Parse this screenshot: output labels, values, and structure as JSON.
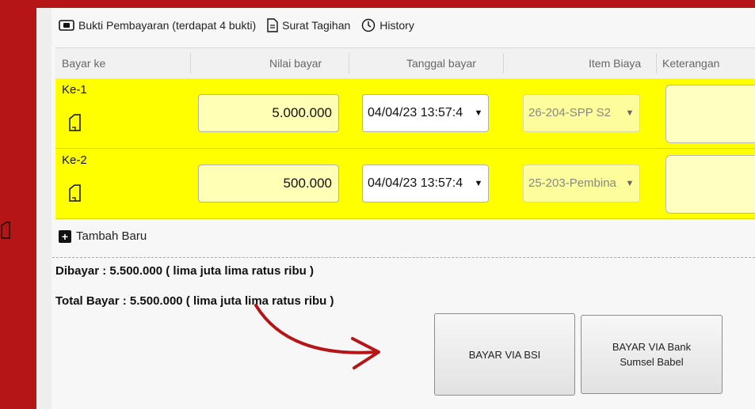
{
  "toolbar": {
    "bukti_label": "Bukti Pembayaran (terdapat 4 bukti)",
    "surat_label": "Surat Tagihan",
    "history_label": "History"
  },
  "table": {
    "headers": [
      "Bayar ke",
      "Nilai bayar",
      "Tanggal bayar",
      "Item Biaya",
      "Keterangan"
    ],
    "rows": [
      {
        "label": "Ke-1",
        "amount": "5.000.000",
        "date": "04/04/23 13:57:4",
        "item": "26-204-SPP S2",
        "note": ""
      },
      {
        "label": "Ke-2",
        "amount": "500.000",
        "date": "04/04/23 13:57:4",
        "item": "25-203-Pembina",
        "note": ""
      }
    ]
  },
  "add_new_label": "Tambah Baru",
  "summary": {
    "dibayar": "Dibayar : 5.500.000 ( lima juta lima ratus ribu )",
    "total": "Total Bayar : 5.500.000 ( lima juta lima ratus ribu )"
  },
  "buttons": {
    "bsi": "BAYAR VIA BSI",
    "sumsel": "BAYAR VIA Bank Sumsel Babel"
  },
  "colors": {
    "background": "#b51516",
    "row_highlight": "#ffff00",
    "arrow": "#b51516"
  },
  "icons": [
    "camera-icon",
    "document-icon",
    "clock-icon",
    "page-icon",
    "plus-icon",
    "arrow-annotation"
  ]
}
